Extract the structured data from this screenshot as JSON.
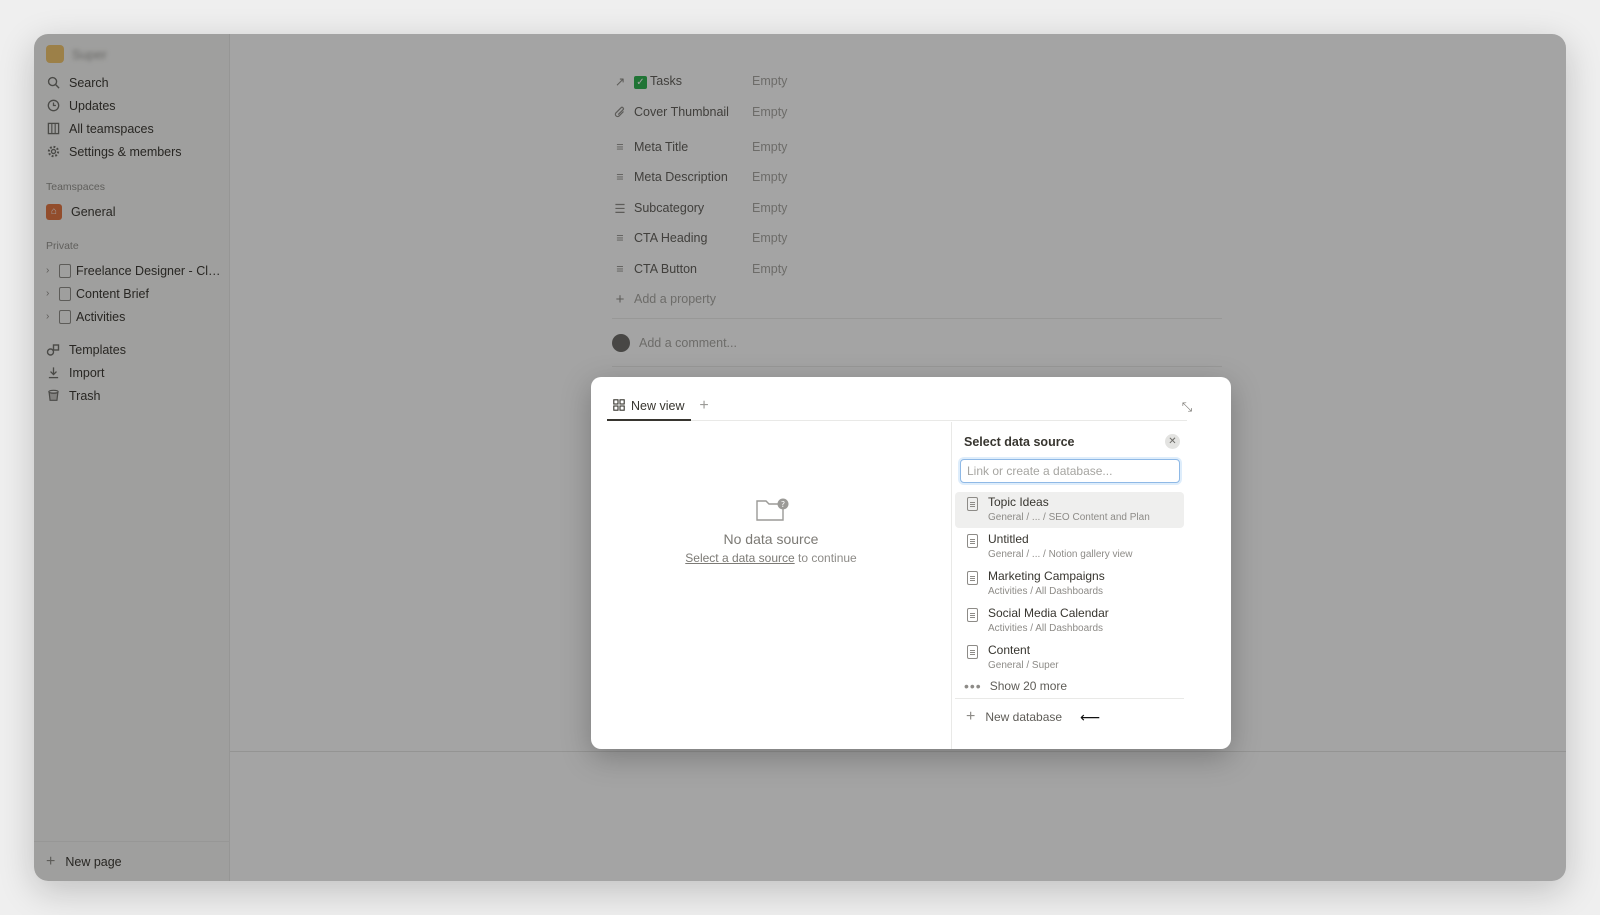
{
  "sidebar": {
    "workspace_name": "Super",
    "nav": [
      {
        "label": "Search",
        "icon": "search-icon"
      },
      {
        "label": "Updates",
        "icon": "clock-icon"
      },
      {
        "label": "All teamspaces",
        "icon": "grid-icon"
      },
      {
        "label": "Settings & members",
        "icon": "gear-icon"
      }
    ],
    "teamspaces_label": "Teamspaces",
    "teamspace_general": "General",
    "private_label": "Private",
    "private_pages": [
      {
        "label": "Freelance Designer - Cli..."
      },
      {
        "label": "Content Brief"
      },
      {
        "label": "Activities"
      }
    ],
    "bottom_nav": [
      {
        "label": "Templates",
        "icon": "shapes-icon"
      },
      {
        "label": "Import",
        "icon": "download-icon"
      },
      {
        "label": "Trash",
        "icon": "trash-icon"
      }
    ],
    "new_page_label": "New page"
  },
  "page": {
    "properties": [
      {
        "name": "Tasks",
        "value": "Empty",
        "icon": "relation-arrow-icon"
      },
      {
        "name": "Cover Thumbnail",
        "value": "Empty",
        "icon": "paperclip-icon"
      },
      {
        "name": "Meta Title",
        "value": "Empty",
        "icon": "text-lines-icon"
      },
      {
        "name": "Meta Description",
        "value": "Empty",
        "icon": "text-lines-icon"
      },
      {
        "name": "Subcategory",
        "value": "Empty",
        "icon": "list-icon"
      },
      {
        "name": "CTA Heading",
        "value": "Empty",
        "icon": "text-lines-icon"
      },
      {
        "name": "CTA Button",
        "value": "Empty",
        "icon": "text-lines-icon"
      }
    ],
    "add_property_label": "Add a property",
    "comment_placeholder": "Add a comment..."
  },
  "modal": {
    "tab_label": "New view",
    "empty_title": "No data source",
    "empty_link": "Select a data source",
    "empty_suffix": "to continue",
    "panel_title": "Select data source",
    "search_placeholder": "Link or create a database...",
    "items": [
      {
        "name": "Topic Ideas",
        "path": "General / ... / SEO Content and Plan"
      },
      {
        "name": "Untitled",
        "path": "General / ... / Notion gallery view"
      },
      {
        "name": "Marketing Campaigns",
        "path": "Activities / All Dashboards"
      },
      {
        "name": "Social Media Calendar",
        "path": "Activities / All Dashboards"
      },
      {
        "name": "Content",
        "path": "General / Super"
      }
    ],
    "show_more_label": "Show 20 more",
    "new_database_label": "New database"
  }
}
